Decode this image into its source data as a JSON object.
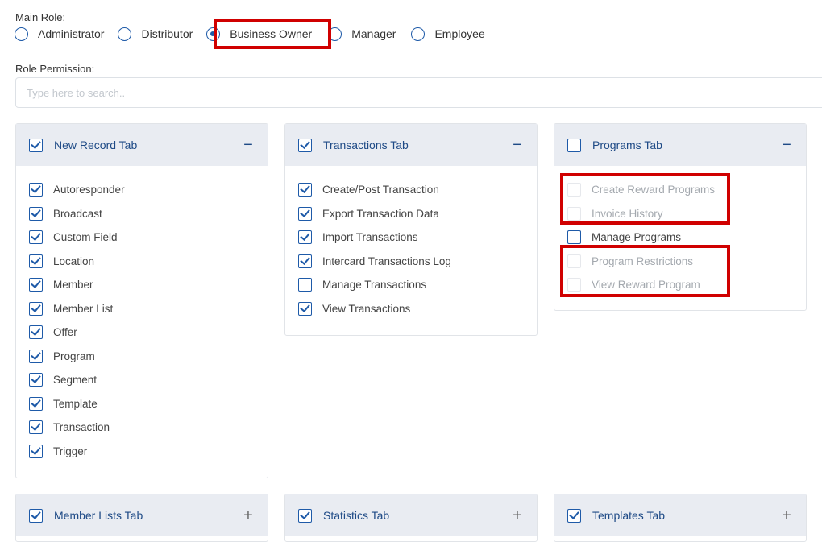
{
  "main_role": {
    "label": "Main Role:",
    "options": [
      {
        "label": "Administrator",
        "selected": false
      },
      {
        "label": "Distributor",
        "selected": false
      },
      {
        "label": "Business Owner",
        "selected": true
      },
      {
        "label": "Manager",
        "selected": false
      },
      {
        "label": "Employee",
        "selected": false
      }
    ]
  },
  "role_permission": {
    "label": "Role Permission:",
    "search_placeholder": "Type here to search.."
  },
  "cards": [
    {
      "title": "New Record Tab",
      "checked": true,
      "toggle": "−",
      "items": [
        {
          "label": "Autoresponder",
          "checked": true,
          "disabled": false
        },
        {
          "label": "Broadcast",
          "checked": true,
          "disabled": false
        },
        {
          "label": "Custom Field",
          "checked": true,
          "disabled": false
        },
        {
          "label": "Location",
          "checked": true,
          "disabled": false
        },
        {
          "label": "Member",
          "checked": true,
          "disabled": false
        },
        {
          "label": "Member List",
          "checked": true,
          "disabled": false
        },
        {
          "label": "Offer",
          "checked": true,
          "disabled": false
        },
        {
          "label": "Program",
          "checked": true,
          "disabled": false
        },
        {
          "label": "Segment",
          "checked": true,
          "disabled": false
        },
        {
          "label": "Template",
          "checked": true,
          "disabled": false
        },
        {
          "label": "Transaction",
          "checked": true,
          "disabled": false
        },
        {
          "label": "Trigger",
          "checked": true,
          "disabled": false
        }
      ]
    },
    {
      "title": "Transactions Tab",
      "checked": true,
      "toggle": "−",
      "items": [
        {
          "label": "Create/Post Transaction",
          "checked": true,
          "disabled": false
        },
        {
          "label": "Export Transaction Data",
          "checked": true,
          "disabled": false
        },
        {
          "label": "Import Transactions",
          "checked": true,
          "disabled": false
        },
        {
          "label": "Intercard Transactions Log",
          "checked": true,
          "disabled": false
        },
        {
          "label": "Manage Transactions",
          "checked": false,
          "disabled": false
        },
        {
          "label": "View Transactions",
          "checked": true,
          "disabled": false
        }
      ]
    },
    {
      "title": "Programs Tab",
      "checked": false,
      "toggle": "−",
      "items": [
        {
          "label": "Create Reward Programs",
          "checked": false,
          "disabled": true
        },
        {
          "label": "Invoice History",
          "checked": false,
          "disabled": true
        },
        {
          "label": "Manage Programs",
          "checked": false,
          "disabled": false
        },
        {
          "label": "Program Restrictions",
          "checked": false,
          "disabled": true
        },
        {
          "label": "View Reward Program",
          "checked": false,
          "disabled": true
        }
      ]
    },
    {
      "title": "Member Lists Tab",
      "checked": true,
      "toggle": "+",
      "items": []
    },
    {
      "title": "Statistics Tab",
      "checked": true,
      "toggle": "+",
      "items": []
    },
    {
      "title": "Templates Tab",
      "checked": true,
      "toggle": "+",
      "items": []
    }
  ],
  "colors": {
    "accent": "#1e5aa8",
    "highlight": "#d00000",
    "card_header": "#e9ecf2"
  }
}
